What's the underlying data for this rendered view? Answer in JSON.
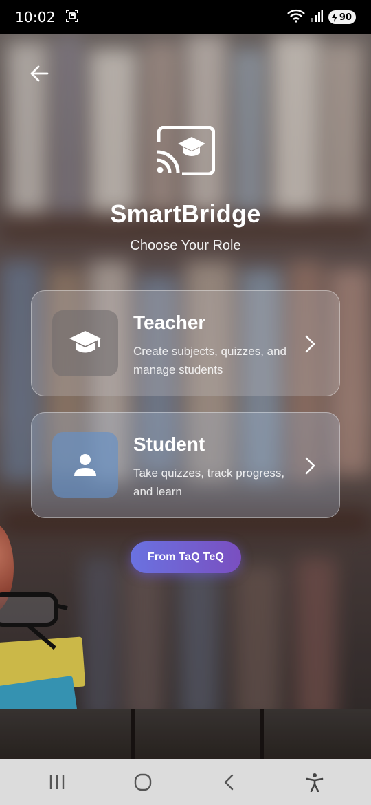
{
  "status_bar": {
    "time": "10:02",
    "battery_level": "90",
    "icons": [
      "screenshot-icon",
      "wifi-icon",
      "signal-icon",
      "battery-icon"
    ]
  },
  "header": {
    "back_icon": "arrow-left-icon",
    "logo_icon": "cast-graduation-cap-icon",
    "app_title": "SmartBridge",
    "subtitle": "Choose Your Role"
  },
  "roles": [
    {
      "title": "Teacher",
      "description": "Create subjects, quizzes, and manage students",
      "icon": "graduation-cap-icon"
    },
    {
      "title": "Student",
      "description": "Take quizzes, track progress, and learn",
      "icon": "person-icon"
    }
  ],
  "credit": {
    "label": "From TaQ TeQ"
  },
  "colors": {
    "accent_start": "#6a72e0",
    "accent_end": "#7a4fc0",
    "student_icon_bg": "#6491c8",
    "teacher_icon_bg": "#6e696c"
  },
  "nav_bar": {
    "icons": [
      "recent-apps-icon",
      "home-icon",
      "back-icon",
      "accessibility-icon"
    ]
  }
}
